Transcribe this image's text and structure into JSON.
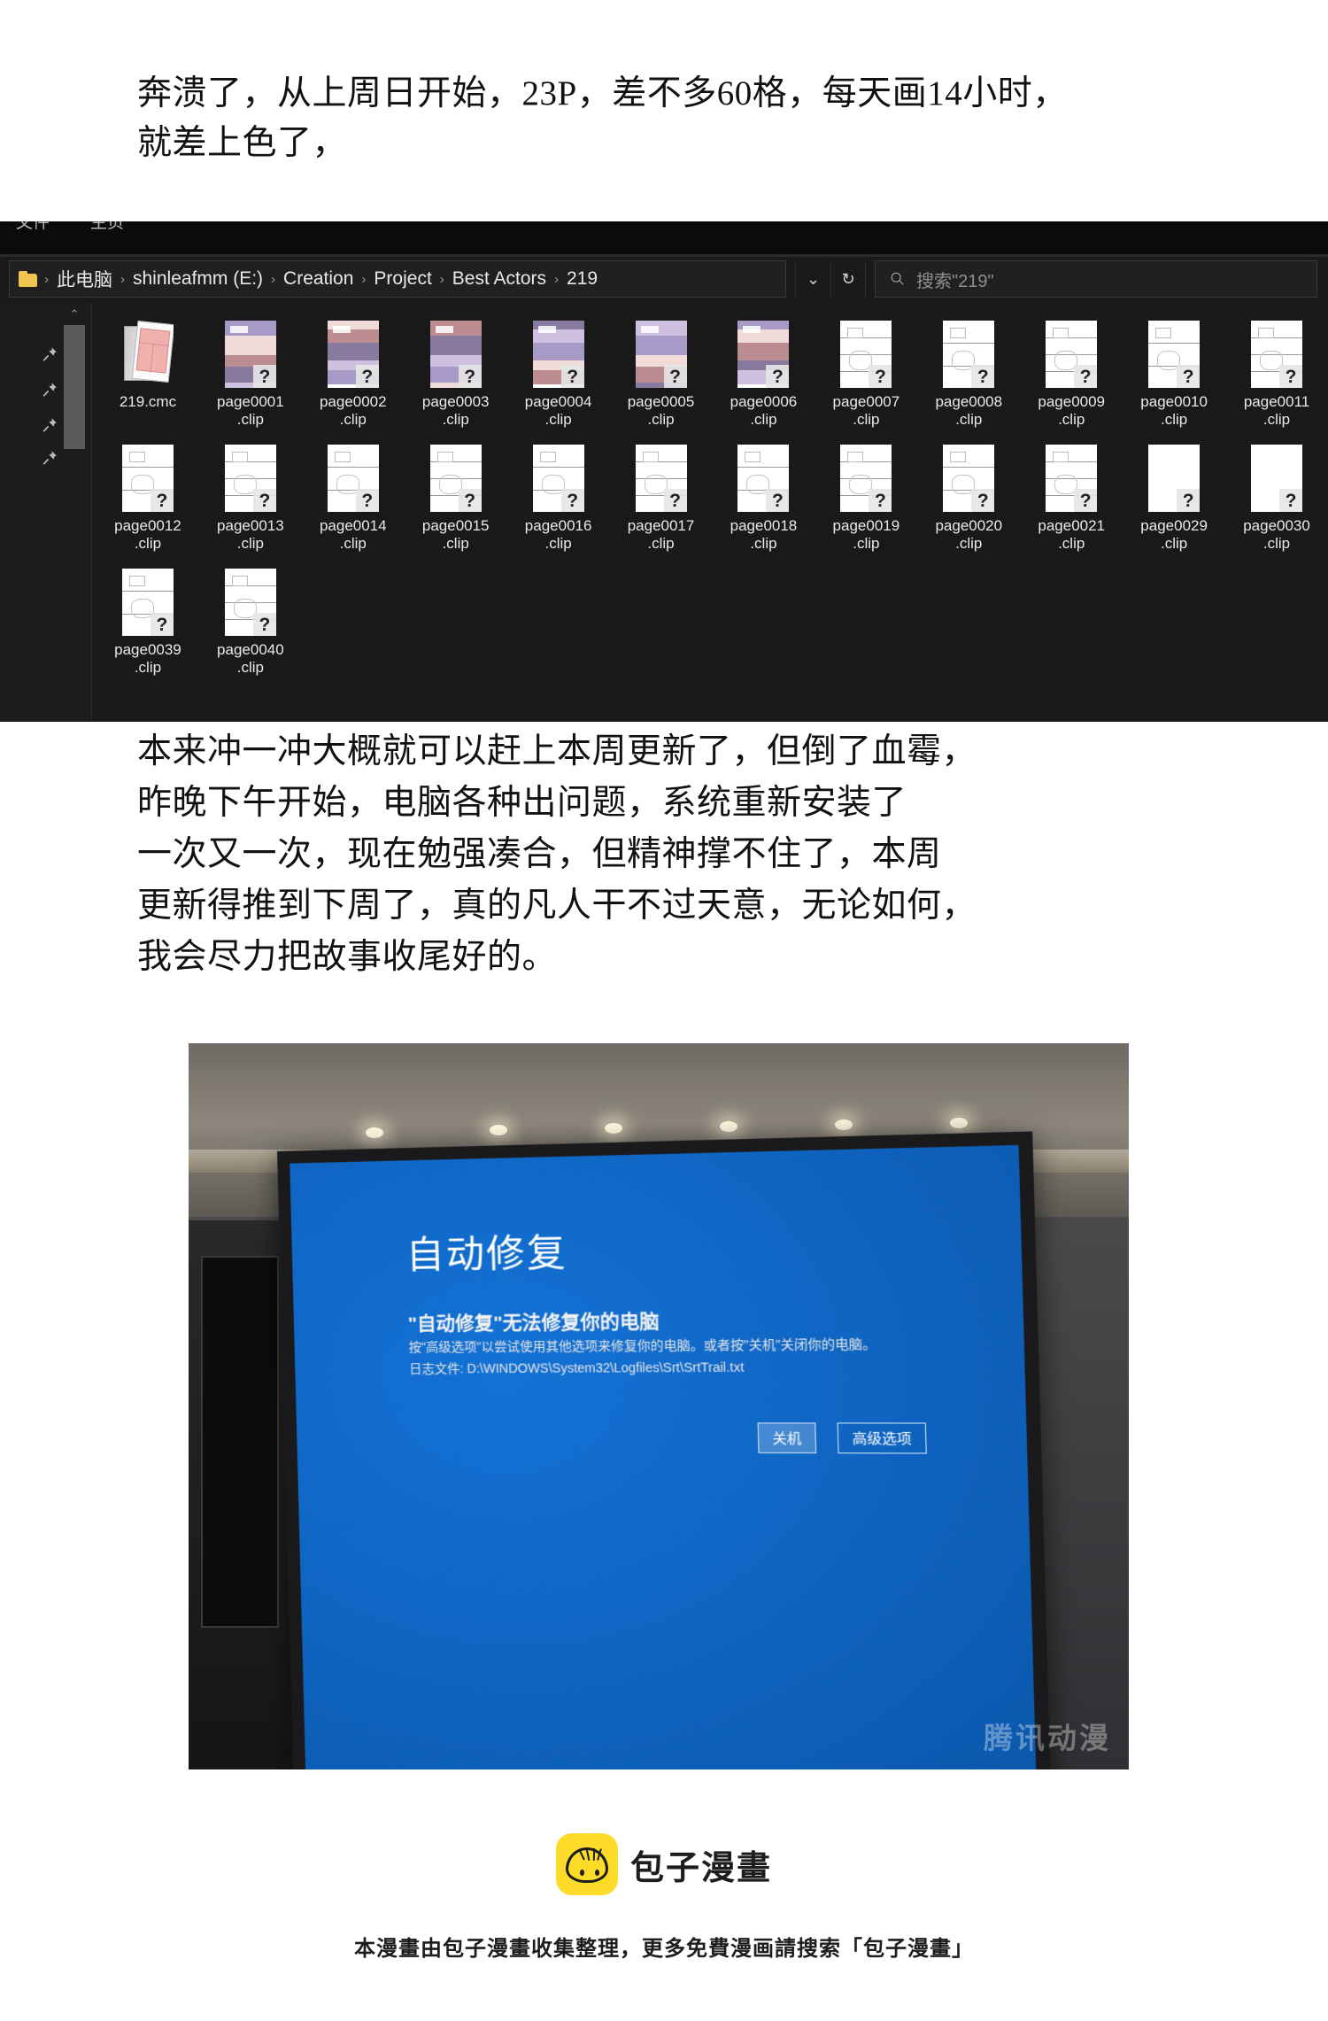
{
  "narration_top": {
    "lines": [
      "奔溃了，从上周日开始，23P，差不多60格，每天画14小时，",
      "就差上色了，"
    ]
  },
  "narration_mid": {
    "lines": [
      "本来冲一冲大概就可以赶上本周更新了，但倒了血霉，",
      "昨晚下午开始，电脑各种出问题，系统重新安装了",
      "一次又一次，现在勉强凑合，但精神撑不住了，本周",
      "更新得推到下周了，真的凡人干不过天意，无论如何，",
      "我会尽力把故事收尾好的。"
    ]
  },
  "explorer": {
    "ribbon_tabs": [
      "文件",
      "主页"
    ],
    "breadcrumb": {
      "folder_icon": "folder-icon",
      "items": [
        "此电脑",
        "shinleafmm (E:)",
        "Creation",
        "Project",
        "Best Actors",
        "219"
      ],
      "separator": "›"
    },
    "chevron_label": "⌄",
    "refresh_label": "↻",
    "search": {
      "icon": "search-icon",
      "placeholder": "搜索\"219\""
    },
    "nav_pane": {
      "scroll_up": "⌃",
      "pins": [
        "pin-icon",
        "pin-icon",
        "pin-icon",
        "pin-icon"
      ]
    },
    "files": [
      {
        "name": "219.cmc",
        "ext": "",
        "kind": "cmc"
      },
      {
        "name": "page0001",
        "ext": ".clip",
        "kind": "color"
      },
      {
        "name": "page0002",
        "ext": ".clip",
        "kind": "color"
      },
      {
        "name": "page0003",
        "ext": ".clip",
        "kind": "color"
      },
      {
        "name": "page0004",
        "ext": ".clip",
        "kind": "color"
      },
      {
        "name": "page0005",
        "ext": ".clip",
        "kind": "color"
      },
      {
        "name": "page0006",
        "ext": ".clip",
        "kind": "color"
      },
      {
        "name": "page0007",
        "ext": ".clip",
        "kind": "sketch"
      },
      {
        "name": "page0008",
        "ext": ".clip",
        "kind": "sketch"
      },
      {
        "name": "page0009",
        "ext": ".clip",
        "kind": "sketch"
      },
      {
        "name": "page0010",
        "ext": ".clip",
        "kind": "sketch"
      },
      {
        "name": "page0011",
        "ext": ".clip",
        "kind": "sketch"
      },
      {
        "name": "page0012",
        "ext": ".clip",
        "kind": "sketch"
      },
      {
        "name": "page0013",
        "ext": ".clip",
        "kind": "sketch"
      },
      {
        "name": "page0014",
        "ext": ".clip",
        "kind": "sketch"
      },
      {
        "name": "page0015",
        "ext": ".clip",
        "kind": "sketch"
      },
      {
        "name": "page0016",
        "ext": ".clip",
        "kind": "sketch"
      },
      {
        "name": "page0017",
        "ext": ".clip",
        "kind": "sketch"
      },
      {
        "name": "page0018",
        "ext": ".clip",
        "kind": "sketch"
      },
      {
        "name": "page0019",
        "ext": ".clip",
        "kind": "sketch"
      },
      {
        "name": "page0020",
        "ext": ".clip",
        "kind": "sketch"
      },
      {
        "name": "page0021",
        "ext": ".clip",
        "kind": "sketch"
      },
      {
        "name": "page0029",
        "ext": ".clip",
        "kind": "blank"
      },
      {
        "name": "page0030",
        "ext": ".clip",
        "kind": "blank"
      },
      {
        "name": "page0039",
        "ext": ".clip",
        "kind": "sketch"
      },
      {
        "name": "page0040",
        "ext": ".clip",
        "kind": "sketch"
      }
    ]
  },
  "photo": {
    "bsod": {
      "title": "自动修复",
      "subtitle": "\"自动修复\"无法修复你的电脑",
      "line1": "按\"高级选项\"以尝试使用其他选项来修复你的电脑。或者按\"关机\"关闭你的电脑。",
      "line2": "日志文件: D:\\WINDOWS\\System32\\Logfiles\\Srt\\SrtTrail.txt",
      "buttons": [
        "关机",
        "高级选项"
      ]
    },
    "watermark": "腾讯动漫"
  },
  "footer": {
    "brand": "包子漫畫",
    "logo_icon": "bun-logo-icon",
    "note": "本漫畫由包子漫畫收集整理，更多免費漫画請搜索「包子漫畫」"
  },
  "colors": {
    "explorer_bg": "#191919",
    "bsod_blue": "#0f66c4",
    "brand_yellow": "#fcdb29",
    "folder_yellow": "#f0c550"
  }
}
